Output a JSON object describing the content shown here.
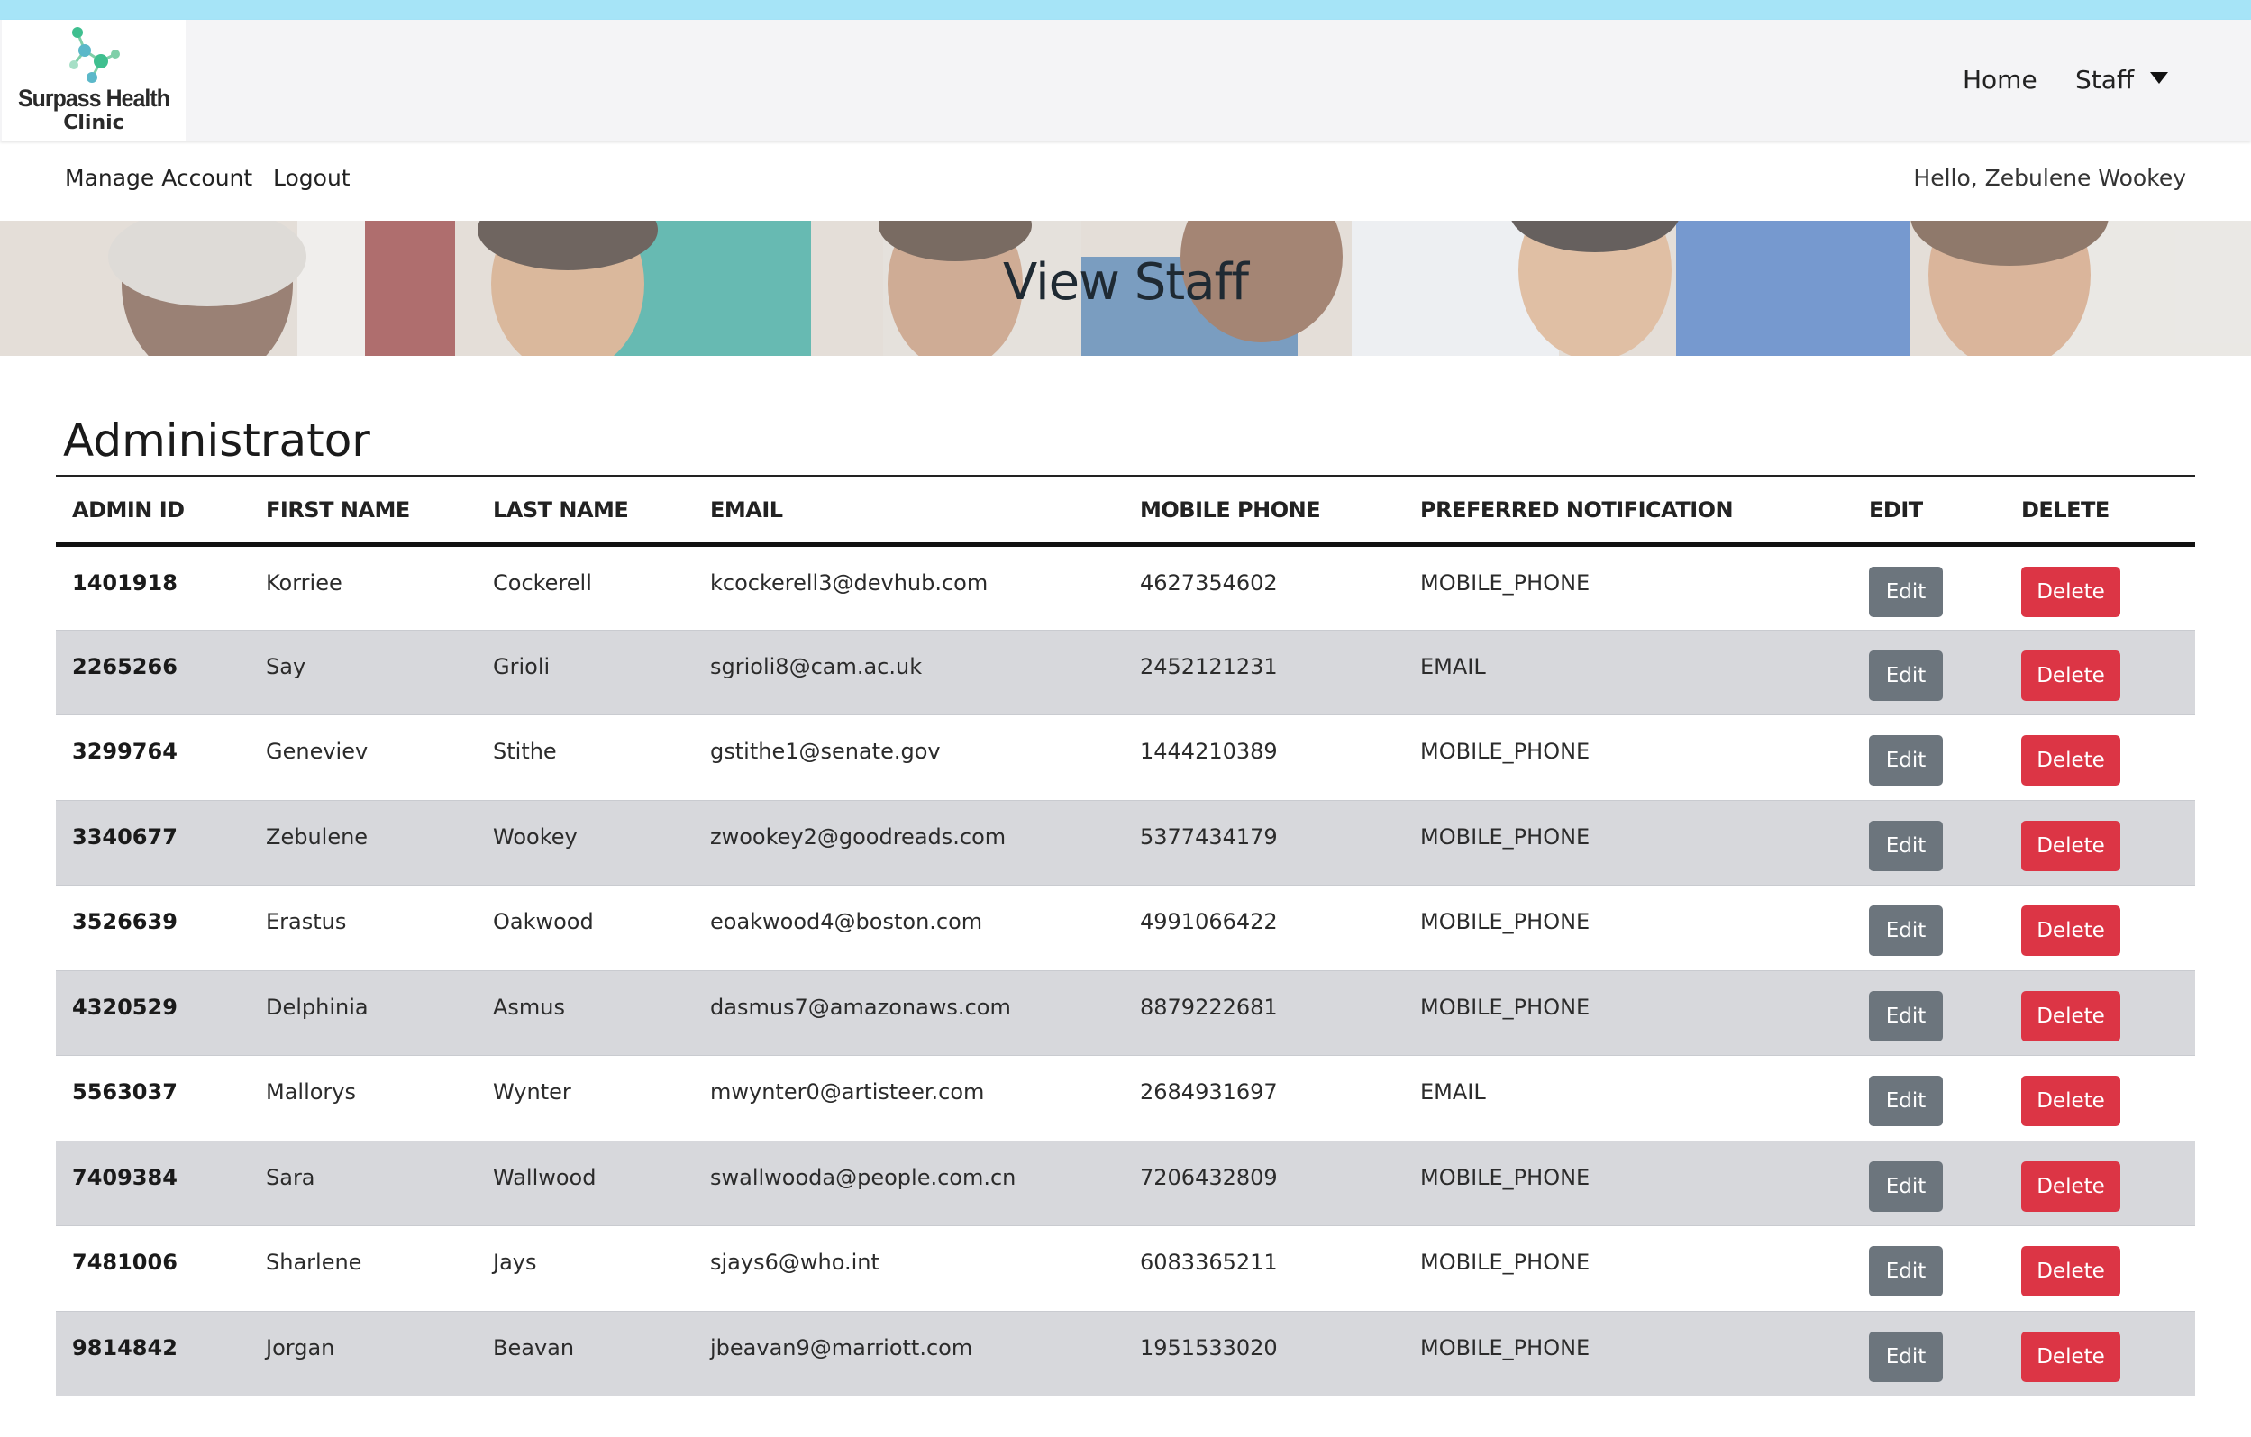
{
  "brand": {
    "name_line1": "Surpass Health",
    "name_line2": "Clinic",
    "colors": {
      "logo_green": "#3fbf8f",
      "logo_teal": "#5bb8c9"
    }
  },
  "navbar": {
    "home_label": "Home",
    "staff_label": "Staff"
  },
  "subnav": {
    "manage_account_label": "Manage Account",
    "logout_label": "Logout",
    "greeting": "Hello, Zebulene Wookey"
  },
  "banner": {
    "title": "View Staff"
  },
  "section": {
    "title": "Administrator"
  },
  "table": {
    "headers": [
      "ADMIN ID",
      "FIRST NAME",
      "LAST NAME",
      "EMAIL",
      "MOBILE PHONE",
      "PREFERRED NOTIFICATION",
      "EDIT",
      "DELETE"
    ],
    "edit_label": "Edit",
    "delete_label": "Delete",
    "rows": [
      {
        "id": "1401918",
        "first": "Korriee",
        "last": "Cockerell",
        "email": "kcockerell3@devhub.com",
        "phone": "4627354602",
        "notify": "MOBILE_PHONE"
      },
      {
        "id": "2265266",
        "first": "Say",
        "last": "Grioli",
        "email": "sgrioli8@cam.ac.uk",
        "phone": "2452121231",
        "notify": "EMAIL"
      },
      {
        "id": "3299764",
        "first": "Geneviev",
        "last": "Stithe",
        "email": "gstithe1@senate.gov",
        "phone": "1444210389",
        "notify": "MOBILE_PHONE"
      },
      {
        "id": "3340677",
        "first": "Zebulene",
        "last": "Wookey",
        "email": "zwookey2@goodreads.com",
        "phone": "5377434179",
        "notify": "MOBILE_PHONE"
      },
      {
        "id": "3526639",
        "first": "Erastus",
        "last": "Oakwood",
        "email": "eoakwood4@boston.com",
        "phone": "4991066422",
        "notify": "MOBILE_PHONE"
      },
      {
        "id": "4320529",
        "first": "Delphinia",
        "last": "Asmus",
        "email": "dasmus7@amazonaws.com",
        "phone": "8879222681",
        "notify": "MOBILE_PHONE"
      },
      {
        "id": "5563037",
        "first": "Mallorys",
        "last": "Wynter",
        "email": "mwynter0@artisteer.com",
        "phone": "2684931697",
        "notify": "EMAIL"
      },
      {
        "id": "7409384",
        "first": "Sara",
        "last": "Wallwood",
        "email": "swallwooda@people.com.cn",
        "phone": "7206432809",
        "notify": "MOBILE_PHONE"
      },
      {
        "id": "7481006",
        "first": "Sharlene",
        "last": "Jays",
        "email": "sjays6@who.int",
        "phone": "6083365211",
        "notify": "MOBILE_PHONE"
      },
      {
        "id": "9814842",
        "first": "Jorgan",
        "last": "Beavan",
        "email": "jbeavan9@marriott.com",
        "phone": "1951533020",
        "notify": "MOBILE_PHONE"
      }
    ]
  },
  "colors": {
    "edit_button": "#6c757d",
    "delete_button": "#dc3545",
    "top_strip": "#a6e4f7",
    "row_stripe": "#d7d8dc"
  }
}
